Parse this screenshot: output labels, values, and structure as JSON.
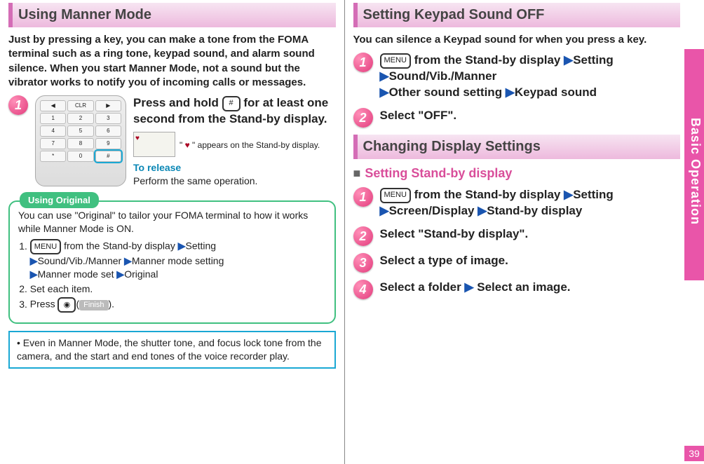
{
  "page_number": "39",
  "side_tab": "Basic Operation",
  "left": {
    "title": "Using Manner Mode",
    "intro": "Just by pressing a key, you can make a tone from the FOMA terminal such as a ring tone, keypad sound, and alarm sound silence. When you start Manner Mode, not a sound but the vibrator works to notify you of incoming calls or messages.",
    "step1_num": "1",
    "step1_text_a": "Press and hold ",
    "hash_key": "#",
    "step1_text_b": " for at least one second from the Stand-by display.",
    "appears_prefix": "\" ",
    "appears_suffix": " \" appears on the Stand-by display.",
    "release_label": "To release",
    "release_body": "Perform the same operation.",
    "callout_tab": "Using Original",
    "callout_intro": "You can use \"Original\" to tailor your FOMA terminal to how it works while Manner Mode is ON.",
    "callout_li1_a": " from the Stand-by display",
    "callout_li1_b": "Setting",
    "callout_li1_c": "Sound/Vib./Manner",
    "callout_li1_d": "Manner mode setting",
    "callout_li1_e": "Manner mode set",
    "callout_li1_f": "Original",
    "callout_li2": "Set each item.",
    "callout_li3_a": "Press ",
    "callout_li3_finish": "Finish",
    "callout_li3_b": ".",
    "menu_label": "MENU",
    "camera_label": "◉",
    "note": "• Even in Manner Mode, the shutter tone, and focus lock tone from the camera, and the start and end tones of the voice recorder play."
  },
  "right": {
    "title1": "Setting Keypad Sound OFF",
    "intro1": "You can silence a Keypad sound for when you press a key.",
    "r1_num": "1",
    "r1_a": " from the Stand-by display",
    "r1_b": "Setting",
    "r1_c": "Sound/Vib./Manner",
    "r1_d": "Other sound setting",
    "r1_e": "Keypad sound",
    "r2_num": "2",
    "r2_text": "Select \"OFF\".",
    "title2": "Changing Display Settings",
    "sub_title": "Setting Stand-by display",
    "d1_num": "1",
    "d1_a": " from the Stand-by display",
    "d1_b": "Setting",
    "d1_c": "Screen/Display",
    "d1_d": "Stand-by display",
    "d2_num": "2",
    "d2_text": "Select \"Stand-by display\".",
    "d3_num": "3",
    "d3_text": "Select a type of image.",
    "d4_num": "4",
    "d4_a": "Select a folder",
    "d4_b": "Select an image.",
    "menu_label": "MENU"
  },
  "arrow": "▶"
}
